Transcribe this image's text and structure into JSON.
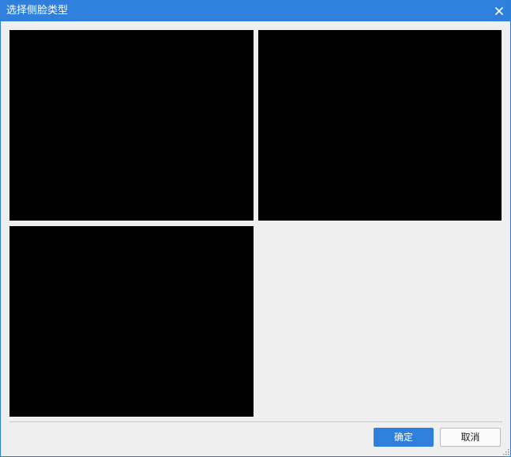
{
  "dialog": {
    "title": "选择侧脸类型",
    "close_icon": "close-icon",
    "title_bar_color": "#2f80dc"
  },
  "options": [
    {
      "name": "face-option-1",
      "color": "#000000"
    },
    {
      "name": "face-option-2",
      "color": "#000000"
    },
    {
      "name": "face-option-3",
      "color": "#000000"
    }
  ],
  "buttons": {
    "confirm_label": "确定",
    "cancel_label": "取消"
  }
}
